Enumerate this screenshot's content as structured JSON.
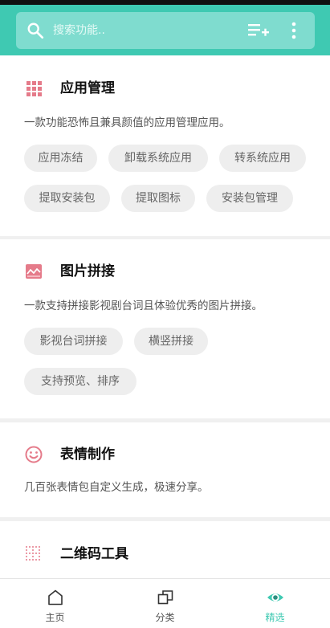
{
  "search": {
    "placeholder": "搜索功能.."
  },
  "toolbar_icons": [
    "search-icon",
    "playlist-add-icon",
    "more-vert-icon"
  ],
  "sections": [
    {
      "icon": "grid-apps-icon",
      "title": "应用管理",
      "description": "一款功能恐怖且兼具颜值的应用管理应用。",
      "tags": [
        "应用冻结",
        "卸载系统应用",
        "转系统应用",
        "提取安装包",
        "提取图标",
        "安装包管理"
      ]
    },
    {
      "icon": "image-stitch-icon",
      "title": "图片拼接",
      "description": "一款支持拼接影视剧台词且体验优秀的图片拼接。",
      "tags": [
        "影视台词拼接",
        "横竖拼接",
        "支持预览、排序"
      ]
    },
    {
      "icon": "smiley-icon",
      "title": "表情制作",
      "description": "几百张表情包自定义生成，极速分享。",
      "tags": []
    },
    {
      "icon": "qrcode-icon",
      "title": "二维码工具",
      "description": "",
      "tags": []
    }
  ],
  "bottom_nav": [
    {
      "label": "主页",
      "icon": "home-icon",
      "active": false
    },
    {
      "label": "分类",
      "icon": "category-icon",
      "active": false
    },
    {
      "label": "精选",
      "icon": "eye-icon",
      "active": true
    }
  ],
  "colors": {
    "accent": "#3fc9b2",
    "icon_pink": "#e57b8a",
    "chip_bg": "#eeeeee"
  }
}
